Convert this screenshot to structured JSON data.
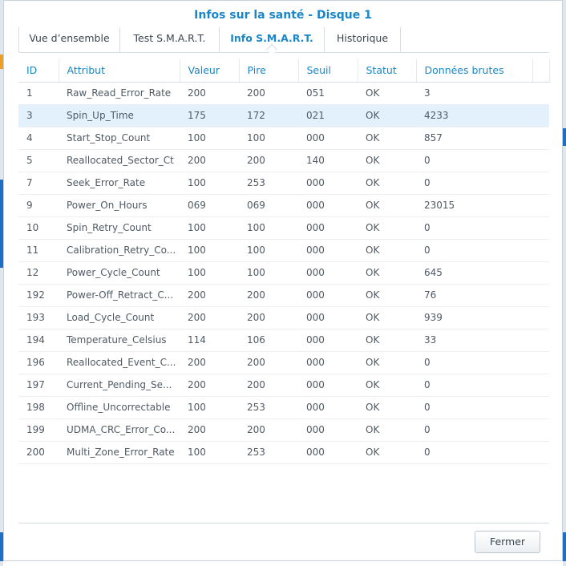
{
  "dialog": {
    "title": "Infos sur la santé - Disque 1"
  },
  "tabs": [
    {
      "label": "Vue d’ensemble"
    },
    {
      "label": "Test S.M.A.R.T."
    },
    {
      "label": "Info S.M.A.R.T."
    },
    {
      "label": "Historique"
    }
  ],
  "active_tab": "Info S.M.A.R.T.",
  "table": {
    "headers": [
      "ID",
      "Attribut",
      "Valeur",
      "Pire",
      "Seuil",
      "Statut",
      "Données brutes"
    ],
    "rows": [
      [
        "1",
        "Raw_Read_Error_Rate",
        "200",
        "200",
        "051",
        "OK",
        "3"
      ],
      [
        "3",
        "Spin_Up_Time",
        "175",
        "172",
        "021",
        "OK",
        "4233"
      ],
      [
        "4",
        "Start_Stop_Count",
        "100",
        "100",
        "000",
        "OK",
        "857"
      ],
      [
        "5",
        "Reallocated_Sector_Ct",
        "200",
        "200",
        "140",
        "OK",
        "0"
      ],
      [
        "7",
        "Seek_Error_Rate",
        "100",
        "253",
        "000",
        "OK",
        "0"
      ],
      [
        "9",
        "Power_On_Hours",
        "069",
        "069",
        "000",
        "OK",
        "23015"
      ],
      [
        "10",
        "Spin_Retry_Count",
        "100",
        "100",
        "000",
        "OK",
        "0"
      ],
      [
        "11",
        "Calibration_Retry_Co...",
        "100",
        "100",
        "000",
        "OK",
        "0"
      ],
      [
        "12",
        "Power_Cycle_Count",
        "100",
        "100",
        "000",
        "OK",
        "645"
      ],
      [
        "192",
        "Power-Off_Retract_C...",
        "200",
        "200",
        "000",
        "OK",
        "76"
      ],
      [
        "193",
        "Load_Cycle_Count",
        "200",
        "200",
        "000",
        "OK",
        "939"
      ],
      [
        "194",
        "Temperature_Celsius",
        "114",
        "106",
        "000",
        "OK",
        "33"
      ],
      [
        "196",
        "Reallocated_Event_C...",
        "200",
        "200",
        "000",
        "OK",
        "0"
      ],
      [
        "197",
        "Current_Pending_Se...",
        "200",
        "200",
        "000",
        "OK",
        "0"
      ],
      [
        "198",
        "Offline_Uncorrectable",
        "100",
        "253",
        "000",
        "OK",
        "0"
      ],
      [
        "199",
        "UDMA_CRC_Error_Co...",
        "200",
        "200",
        "000",
        "OK",
        "0"
      ],
      [
        "200",
        "Multi_Zone_Error_Rate",
        "100",
        "253",
        "000",
        "OK",
        "0"
      ]
    ],
    "selected_row": 1
  },
  "footer": {
    "close_label": "Fermer"
  },
  "colors": {
    "accent": "#1a86c8",
    "selected_row": "#e3f1fc",
    "text": "#505a64"
  }
}
